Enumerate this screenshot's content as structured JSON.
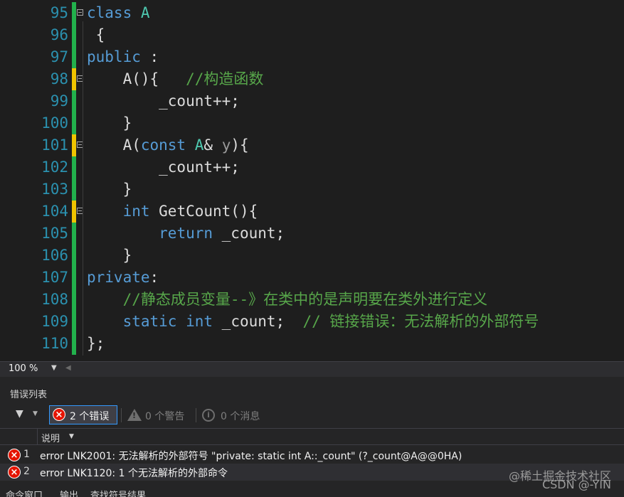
{
  "editor": {
    "lines": [
      {
        "n": "95",
        "bar": "green",
        "fold": true,
        "code": "<span class=\"kw\">class</span> <span class=\"ty\">A</span>"
      },
      {
        "n": "96",
        "bar": "green",
        "fold": false,
        "code": " {"
      },
      {
        "n": "97",
        "bar": "green",
        "fold": false,
        "code": "<span class=\"kw\">public</span> :"
      },
      {
        "n": "98",
        "bar": "yellow",
        "fold": true,
        "code": "    A(){   <span class=\"cm\">//构造函数</span>"
      },
      {
        "n": "99",
        "bar": "green",
        "fold": false,
        "code": "        _count++;"
      },
      {
        "n": "100",
        "bar": "green",
        "fold": false,
        "code": "    }"
      },
      {
        "n": "101",
        "bar": "yellow",
        "fold": true,
        "code": "    A(<span class=\"kw\">const</span> <span class=\"ty\">A</span>&amp; <span class=\"pm\">y</span>){"
      },
      {
        "n": "102",
        "bar": "green",
        "fold": false,
        "code": "        _count++;"
      },
      {
        "n": "103",
        "bar": "green",
        "fold": false,
        "code": "    }"
      },
      {
        "n": "104",
        "bar": "yellow",
        "fold": true,
        "code": "    <span class=\"kw\">int</span> GetCount(){"
      },
      {
        "n": "105",
        "bar": "green",
        "fold": false,
        "code": "        <span class=\"kw\">return</span> _count;"
      },
      {
        "n": "106",
        "bar": "green",
        "fold": false,
        "code": "    }"
      },
      {
        "n": "107",
        "bar": "green",
        "fold": false,
        "code": "<span class=\"kw\">private</span>:"
      },
      {
        "n": "108",
        "bar": "green",
        "fold": false,
        "code": "    <span class=\"cm\">//静态成员变量--》在类中的是声明要在类外进行定义</span>"
      },
      {
        "n": "109",
        "bar": "green",
        "fold": false,
        "code": "    <span class=\"kw\">static</span> <span class=\"kw\">int</span> _count;  <span class=\"cm\">// 链接错误：无法解析的外部符号</span>"
      },
      {
        "n": "110",
        "bar": "green",
        "fold": false,
        "code": "};"
      }
    ],
    "colors": {
      "green": "#22b14c",
      "yellow": "#f0c400",
      "keyword": "#569cd6",
      "type": "#4ec9b0",
      "comment": "#57a64a",
      "linenum": "#2b91af"
    }
  },
  "status": {
    "zoom": "100 %"
  },
  "error_list": {
    "title": "错误列表",
    "errors_btn": "2 个错误",
    "warnings": "0 个警告",
    "messages": "0 个消息",
    "column": "说明",
    "rows": [
      {
        "num": "1",
        "desc": "error LNK2001: 无法解析的外部符号 \"private: static int A::_count\" (?_count@A@@0HA)"
      },
      {
        "num": "2",
        "desc": "error LNK1120: 1 个无法解析的外部命令"
      }
    ]
  },
  "bottom_tabs": [
    "命令窗口",
    "输出",
    "查找符号结果"
  ],
  "watermark": [
    "@稀土掘金技术社区",
    "CSDN @-YIN"
  ]
}
